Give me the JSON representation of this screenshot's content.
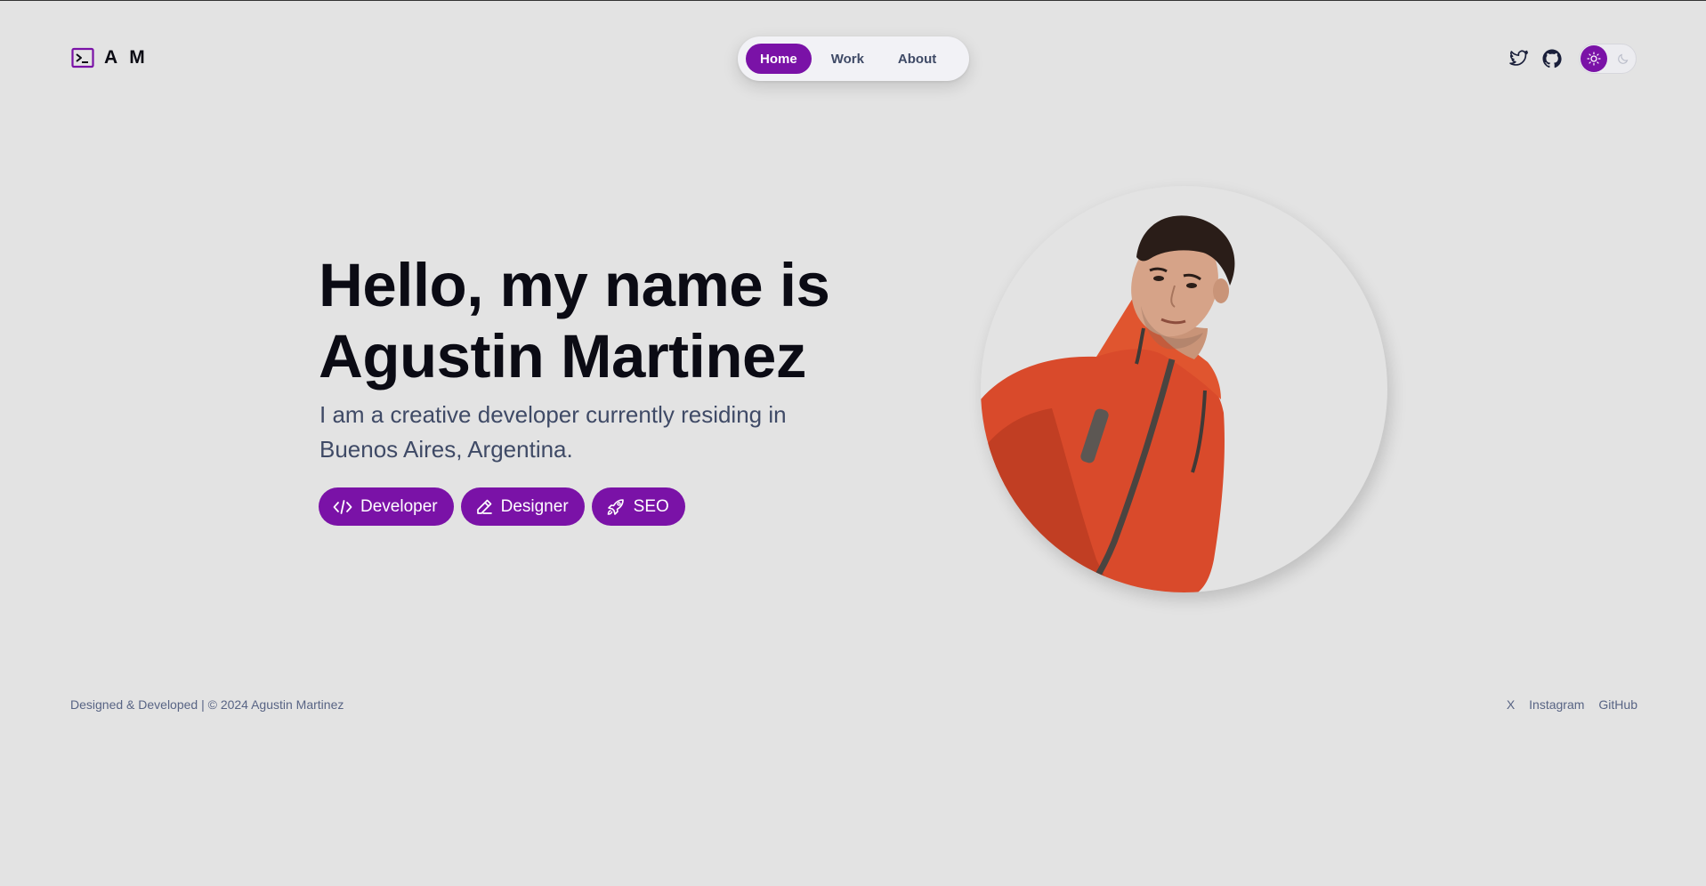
{
  "brand": {
    "logo_text": "A M",
    "logo_icon": "terminal-icon"
  },
  "nav": {
    "items": [
      {
        "label": "Home",
        "active": true
      },
      {
        "label": "Work",
        "active": false
      },
      {
        "label": "About",
        "active": false
      }
    ]
  },
  "header_actions": {
    "social_icons": [
      "twitter-icon",
      "github-icon"
    ],
    "theme_toggle": {
      "mode": "light",
      "icons": [
        "sun-icon",
        "moon-icon"
      ]
    }
  },
  "hero": {
    "title_line1": "Hello, my name is",
    "title_line2": "Agustin Martinez",
    "subtitle_line1": "I am a creative developer currently residing in",
    "subtitle_line2": "Buenos Aires, Argentina.",
    "tags": [
      {
        "label": "Developer",
        "icon": "code-icon"
      },
      {
        "label": "Designer",
        "icon": "pencil-icon"
      },
      {
        "label": "SEO",
        "icon": "rocket-icon"
      }
    ]
  },
  "footer": {
    "copyright": "Designed & Developed | © 2024 Agustin Martinez",
    "links": [
      "X",
      "Instagram",
      "GitHub"
    ]
  },
  "colors": {
    "accent": "#7a12a7",
    "background": "#e3e3e3",
    "text_dark": "#0b0b14",
    "text_muted": "#3f4a66",
    "jacket": "#d94a2b"
  }
}
